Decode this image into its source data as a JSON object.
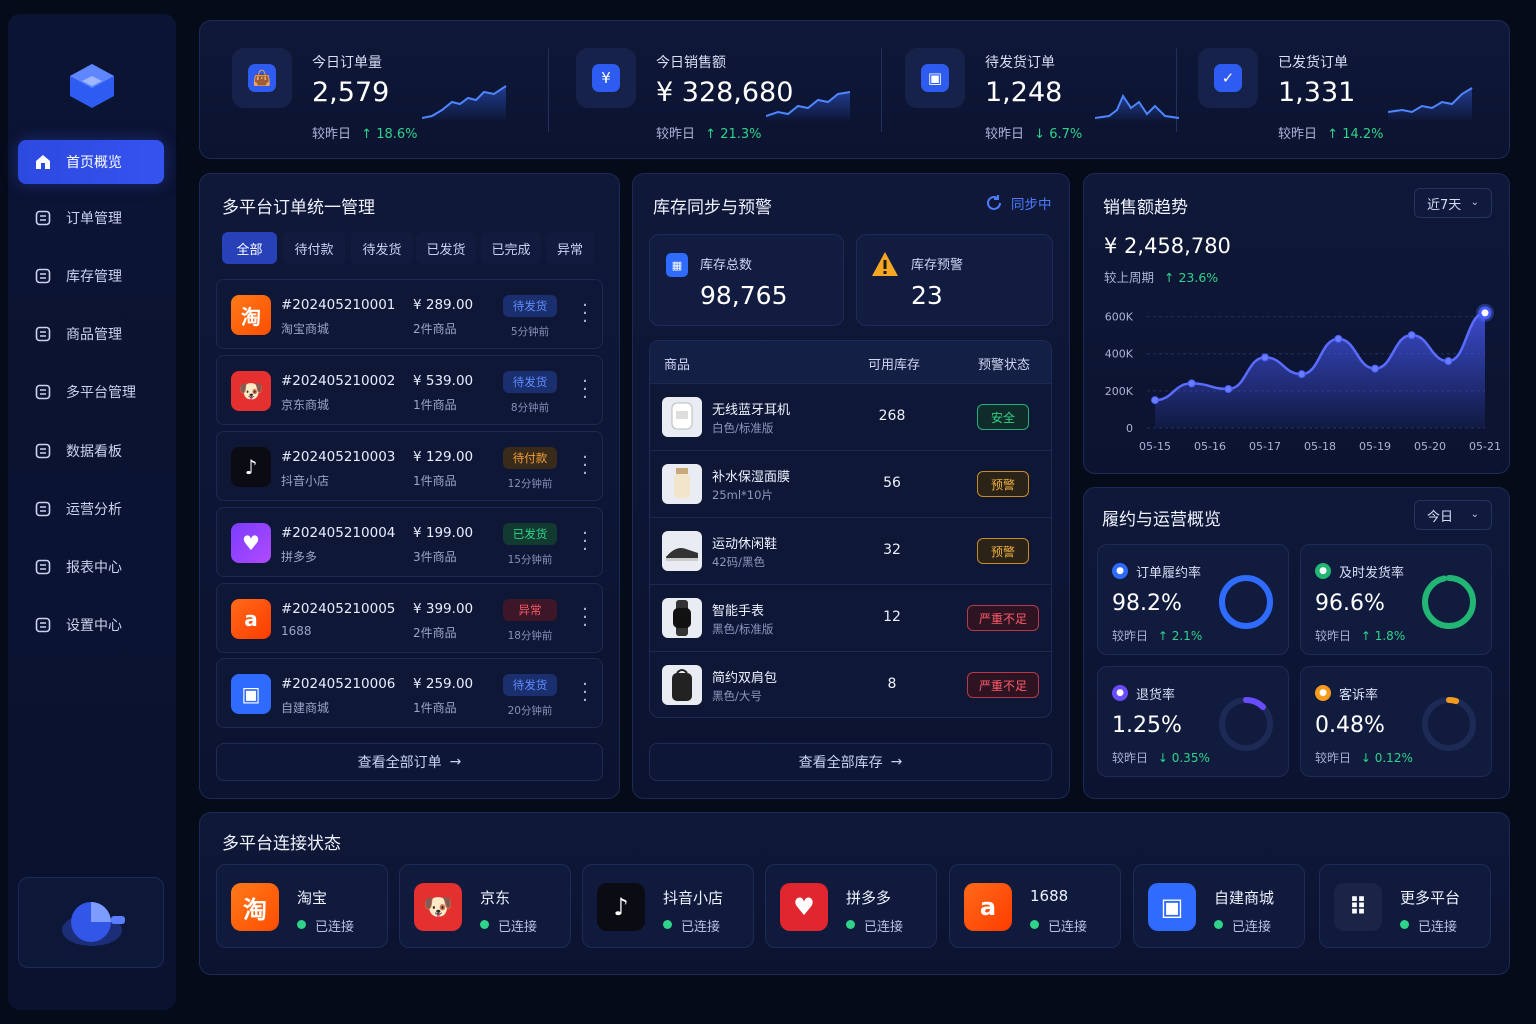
{
  "nav": {
    "items": [
      {
        "label": "首页概览",
        "icon": "home-icon",
        "active": true
      },
      {
        "label": "订单管理",
        "icon": "order-icon"
      },
      {
        "label": "库存管理",
        "icon": "inventory-icon"
      },
      {
        "label": "商品管理",
        "icon": "product-icon"
      },
      {
        "label": "多平台管理",
        "icon": "gear-icon"
      },
      {
        "label": "数据看板",
        "icon": "chart-icon"
      },
      {
        "label": "运营分析",
        "icon": "pie-icon"
      },
      {
        "label": "报表中心",
        "icon": "report-icon"
      },
      {
        "label": "设置中心",
        "icon": "settings-icon"
      }
    ]
  },
  "stats": [
    {
      "label": "今日订单量",
      "value": "2,579",
      "compare": "较昨日",
      "change": "18.6%",
      "dir": "up",
      "icon": "bag-icon"
    },
    {
      "label": "今日销售额",
      "value": "¥ 328,680",
      "compare": "较昨日",
      "change": "21.3%",
      "dir": "up",
      "icon": "yen-icon"
    },
    {
      "label": "待发货订单",
      "value": "1,248",
      "compare": "较昨日",
      "change": "6.7%",
      "dir": "down",
      "icon": "box-icon"
    },
    {
      "label": "已发货订单",
      "value": "1,331",
      "compare": "较昨日",
      "change": "14.2%",
      "dir": "up",
      "icon": "check-icon"
    }
  ],
  "orders": {
    "title": "多平台订单统一管理",
    "tabs": [
      "全部",
      "待付款",
      "待发货",
      "已发货",
      "已完成",
      "异常"
    ],
    "rows": [
      {
        "no": "#202405210001",
        "shop": "淘宝商城",
        "price": "¥ 289.00",
        "count": "2件商品",
        "status": "待发货",
        "time": "5分钟前",
        "platform": "taobao"
      },
      {
        "no": "#202405210002",
        "shop": "京东商城",
        "price": "¥ 539.00",
        "count": "1件商品",
        "status": "待发货",
        "time": "8分钟前",
        "platform": "jd"
      },
      {
        "no": "#202405210003",
        "shop": "抖音小店",
        "price": "¥ 129.00",
        "count": "1件商品",
        "status": "待付款",
        "time": "12分钟前",
        "platform": "douyin"
      },
      {
        "no": "#202405210004",
        "shop": "拼多多",
        "price": "¥ 199.00",
        "count": "3件商品",
        "status": "已发货",
        "time": "15分钟前",
        "platform": "pdd"
      },
      {
        "no": "#202405210005",
        "shop": "1688",
        "price": "¥ 399.00",
        "count": "2件商品",
        "status": "异常",
        "time": "18分钟前",
        "platform": "1688"
      },
      {
        "no": "#202405210006",
        "shop": "自建商城",
        "price": "¥ 259.00",
        "count": "1件商品",
        "status": "待发货",
        "time": "20分钟前",
        "platform": "self"
      }
    ],
    "view_all": "查看全部订单"
  },
  "inventory": {
    "title": "库存同步与预警",
    "sync": "同步中",
    "total_label": "库存总数",
    "total_value": "98,765",
    "warn_label": "库存预警",
    "warn_value": "23",
    "headers": [
      "商品",
      "可用库存",
      "预警状态"
    ],
    "rows": [
      {
        "name": "无线蓝牙耳机",
        "spec": "白色/标准版",
        "qty": "268",
        "status": "安全"
      },
      {
        "name": "补水保湿面膜",
        "spec": "25ml*10片",
        "qty": "56",
        "status": "预警"
      },
      {
        "name": "运动休闲鞋",
        "spec": "42码/黑色",
        "qty": "32",
        "status": "预警"
      },
      {
        "name": "智能手表",
        "spec": "黑色/标准版",
        "qty": "12",
        "status": "严重不足"
      },
      {
        "name": "简约双肩包",
        "spec": "黑色/大号",
        "qty": "8",
        "status": "严重不足"
      }
    ],
    "view_all": "查看全部库存"
  },
  "trend": {
    "title": "销售额趋势",
    "range": "近7天",
    "total": "¥ 2,458,780",
    "compare": "较上周期",
    "change": "23.6%"
  },
  "chart_data": {
    "type": "area",
    "x": [
      "05-15",
      "05-16",
      "05-17",
      "05-18",
      "05-19",
      "05-20",
      "05-21"
    ],
    "yticks": [
      "0",
      "200K",
      "400K",
      "600K"
    ],
    "ylim": [
      0,
      700000
    ],
    "series": [
      {
        "values": [
          150000,
          240000,
          210000,
          380000,
          290000,
          480000,
          320000,
          500000,
          360000,
          620000
        ]
      }
    ],
    "color": "#4a5cff"
  },
  "ops": {
    "title": "履约与运营概览",
    "range": "今日",
    "kpis": [
      {
        "label": "订单履约率",
        "value": "98.2%",
        "compare": "较昨日",
        "change": "2.1%",
        "dir": "up",
        "pct": 98.2,
        "color": "#2f6bff"
      },
      {
        "label": "及时发货率",
        "value": "96.6%",
        "compare": "较昨日",
        "change": "1.8%",
        "dir": "up",
        "pct": 96.6,
        "color": "#22b573"
      },
      {
        "label": "退货率",
        "value": "1.25%",
        "compare": "较昨日",
        "change": "0.35%",
        "dir": "down",
        "pct": 12.5,
        "color": "#6a4cff"
      },
      {
        "label": "客诉率",
        "value": "0.48%",
        "compare": "较昨日",
        "change": "0.12%",
        "dir": "down",
        "pct": 4.8,
        "color": "#f59a1a"
      }
    ]
  },
  "platforms": {
    "title": "多平台连接状态",
    "items": [
      {
        "name": "淘宝",
        "status": "已连接",
        "glyph": "淘"
      },
      {
        "name": "京东",
        "status": "已连接",
        "glyph": "🐶"
      },
      {
        "name": "抖音小店",
        "status": "已连接",
        "glyph": "♪"
      },
      {
        "name": "拼多多",
        "status": "已连接",
        "glyph": "♥"
      },
      {
        "name": "1688",
        "status": "已连接",
        "glyph": "a"
      },
      {
        "name": "自建商城",
        "status": "已连接",
        "glyph": "▣"
      },
      {
        "name": "更多平台",
        "status": "已连接",
        "glyph": "⠿"
      }
    ]
  }
}
